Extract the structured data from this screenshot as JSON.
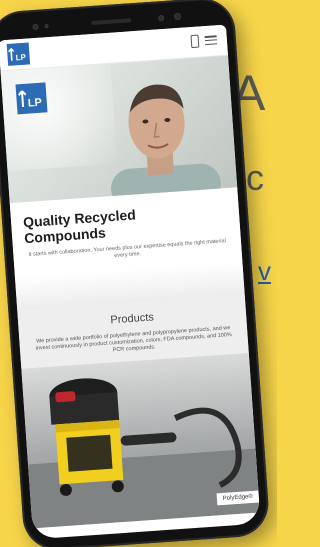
{
  "background_text": {
    "letter_a": "A",
    "letter_c": "c",
    "letter_v": "v"
  },
  "site": {
    "logo_text": "LP",
    "headline_line1": "Quality Recycled",
    "headline_line2": "Compounds",
    "intro": "It starts with collaboration. Your needs plus our expertise equals the right material every time.",
    "products_title": "Products",
    "products_text": "We provide a wide portfolio of polyethylene and polypropylene products, and we invest continuously in product customization, colors, FDA compounds, and 100% PCR compounds.",
    "caption": "PolyEdge®"
  },
  "colors": {
    "backdrop": "#f7d54a",
    "brand_blue": "#2e6bb5",
    "vacuum_yellow": "#f2cf1f"
  },
  "icons": [
    "phone-icon",
    "menu-icon",
    "logo-icon"
  ]
}
